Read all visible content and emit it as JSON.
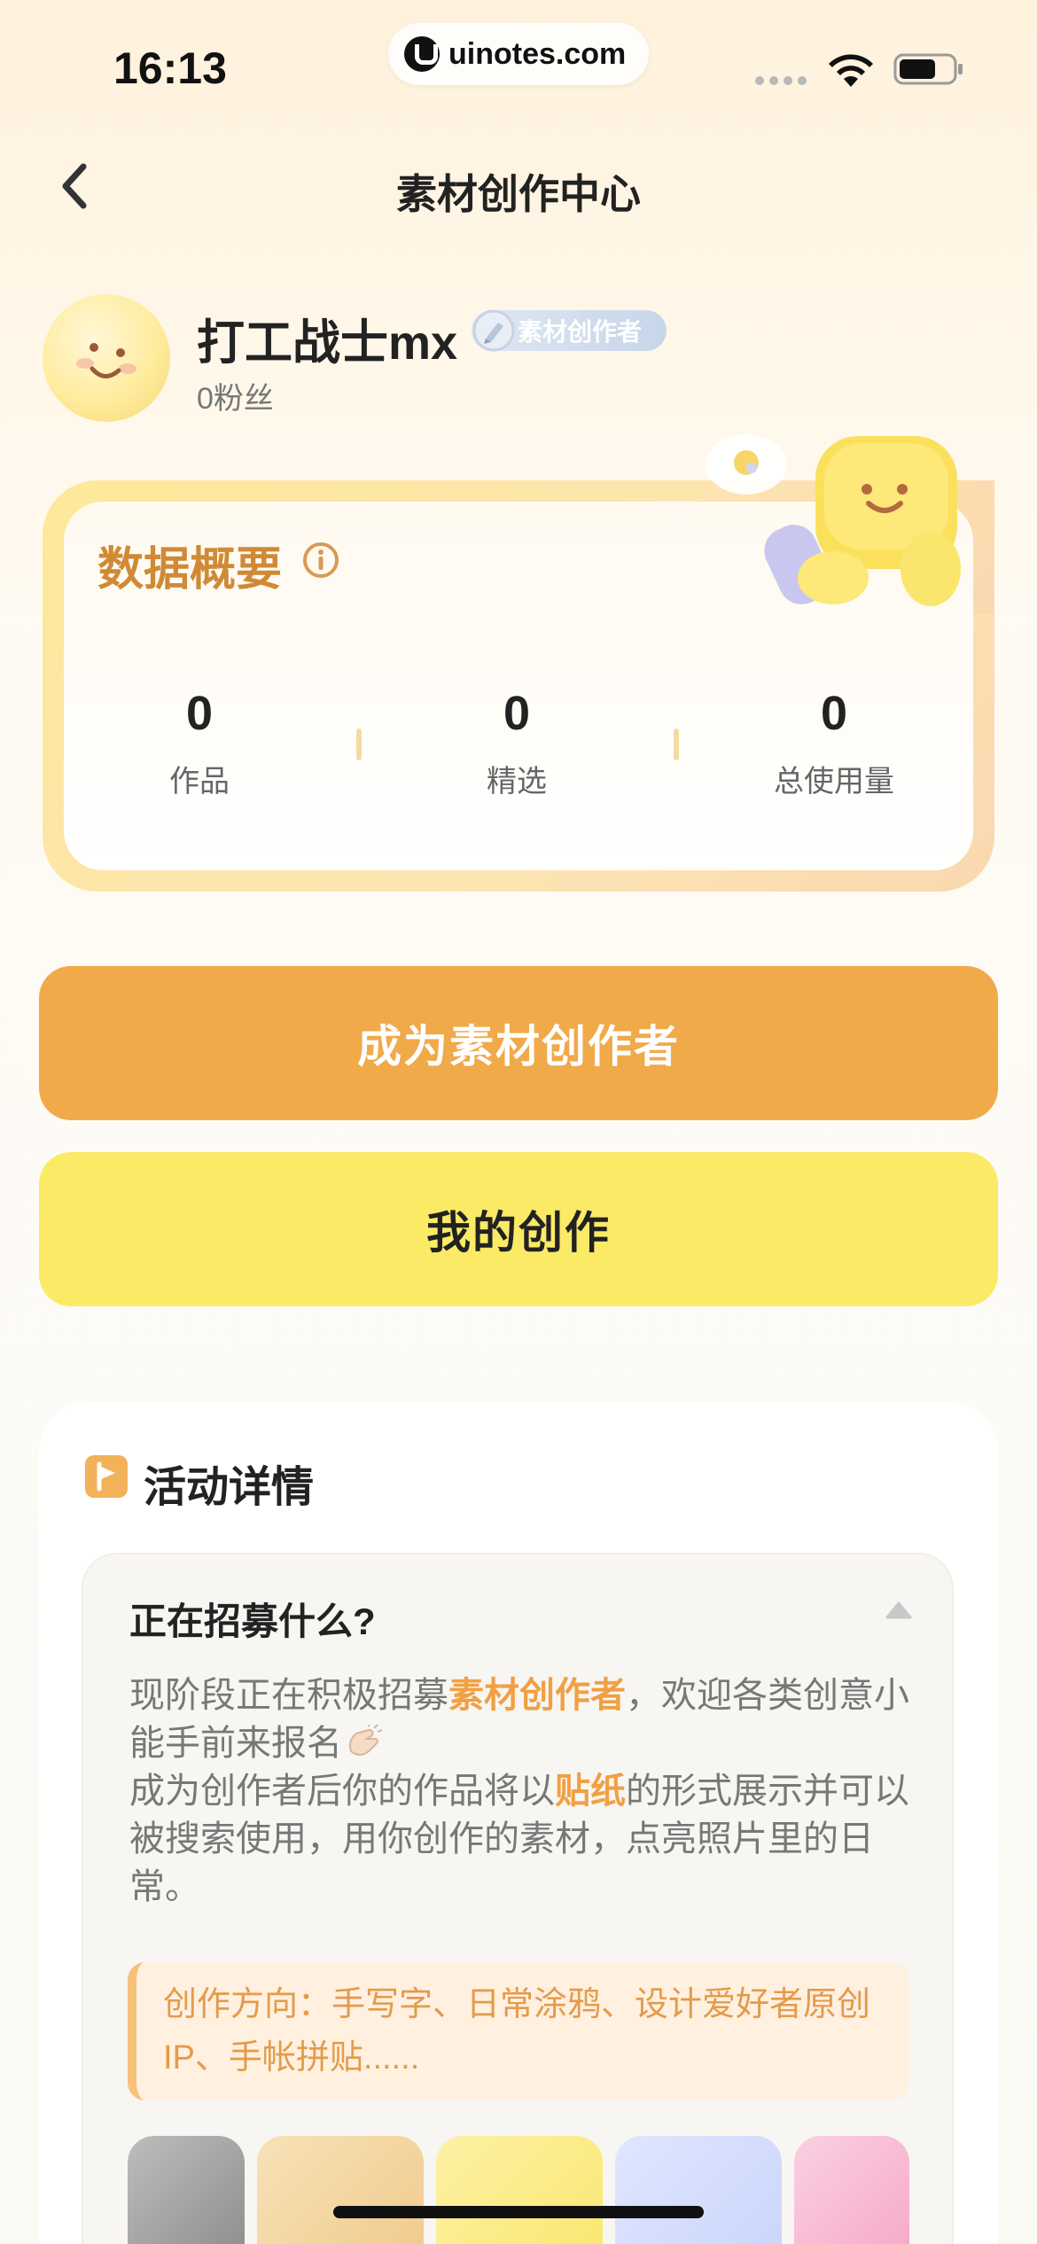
{
  "status_bar": {
    "time": "16:13",
    "watermark": "uinotes.com"
  },
  "nav": {
    "title": "素材创作中心",
    "back_icon": "chevron-left-icon"
  },
  "profile": {
    "username": "打工战士mx",
    "badge": "素材创作者",
    "fans": "0粉丝"
  },
  "data_overview": {
    "title": "数据概要",
    "stats": [
      {
        "value": "0",
        "label": "作品"
      },
      {
        "value": "0",
        "label": "精选"
      },
      {
        "value": "0",
        "label": "总使用量"
      }
    ]
  },
  "actions": {
    "become_creator": "成为素材创作者",
    "my_creations": "我的创作"
  },
  "activity": {
    "title": "活动详情",
    "question": "正在招募什么?",
    "answer_part1": "现阶段正在积极招募",
    "answer_highlight1": "素材创作者",
    "answer_part2": "，欢迎各类创意小能手前来报名",
    "answer_part3": "成为创作者后你的作品将以",
    "answer_highlight2": "贴纸",
    "answer_part4": "的形式展示并可以被搜索使用，用你创作的素材，点亮照片里的日常。",
    "direction": "创作方向：手写字、日常涂鸦、设计爱好者原创IP、手帐拼贴......"
  },
  "colors": {
    "accent_orange": "#f0aa4a",
    "accent_yellow": "#fbea66",
    "title_orange": "#d08a36"
  }
}
